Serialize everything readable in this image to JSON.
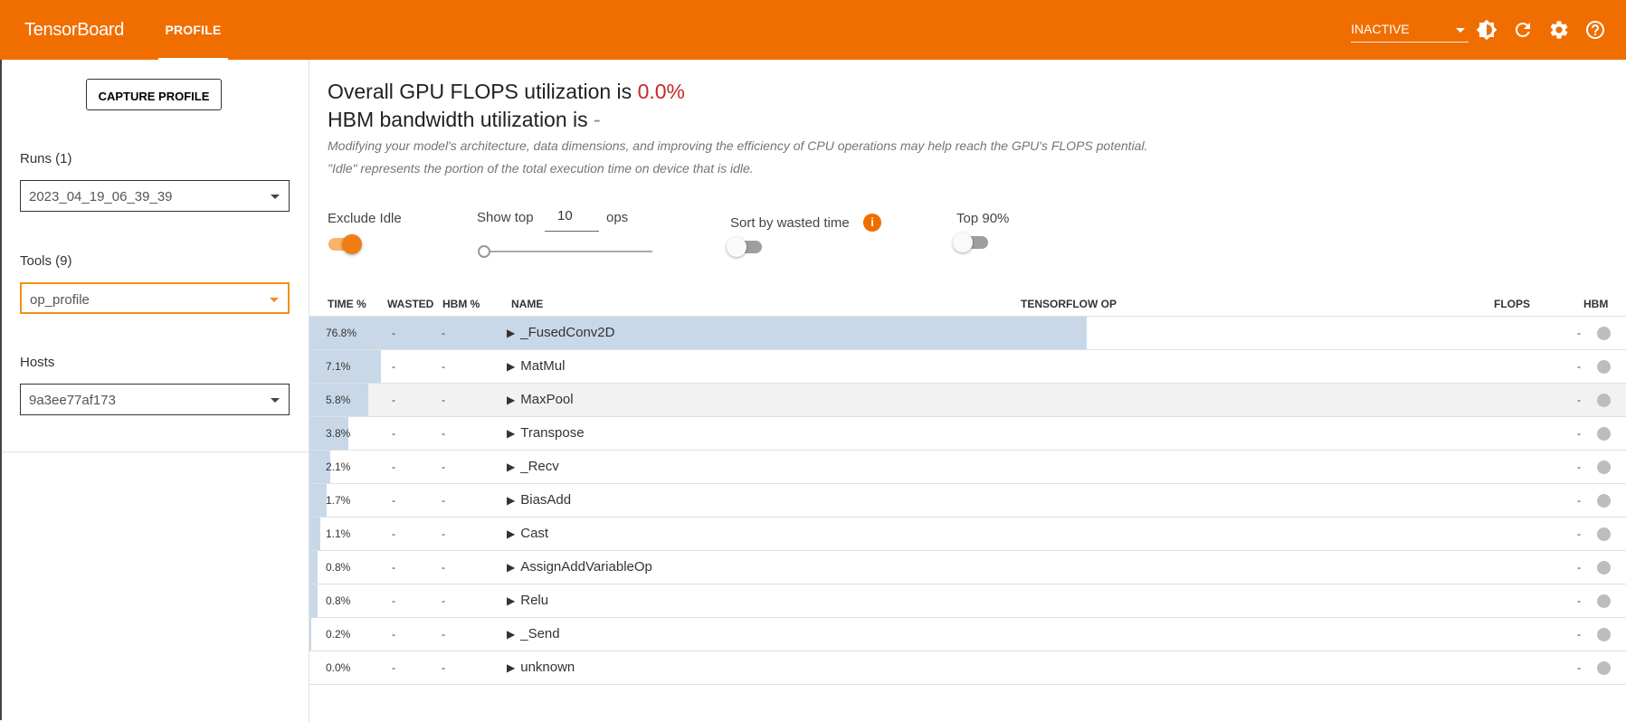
{
  "header": {
    "app_name": "TensorBoard",
    "tab_label": "PROFILE",
    "status_select": "INACTIVE",
    "icons": [
      "theme-toggle-icon",
      "refresh-icon",
      "settings-icon",
      "help-icon"
    ],
    "accent_color": "#f06e00"
  },
  "sidebar": {
    "capture_label": "CAPTURE PROFILE",
    "runs_label": "Runs (1)",
    "runs_value": "2023_04_19_06_39_39",
    "tools_label": "Tools (9)",
    "tools_value": "op_profile",
    "hosts_label": "Hosts",
    "hosts_value": "9a3ee77af173"
  },
  "summary": {
    "flops_prefix": "Overall GPU FLOPS utilization is ",
    "flops_value": "0.0%",
    "hbm_prefix": "HBM bandwidth utilization is ",
    "hbm_value": "-",
    "note1": "Modifying your model's architecture, data dimensions, and improving the efficiency of CPU operations may help reach the GPU's FLOPS potential.",
    "note2": "\"Idle\" represents the portion of the total execution time on device that is idle."
  },
  "controls": {
    "exclude_idle_label": "Exclude Idle",
    "exclude_idle_on": true,
    "show_top_label": "Show top",
    "show_top_value": "10",
    "ops_label": "ops",
    "sort_label": "Sort by wasted time",
    "sort_on": false,
    "info_icon_glyph": "i",
    "top90_label": "Top 90%",
    "top90_on": false
  },
  "table": {
    "headers": {
      "time": "TIME %",
      "wasted": "WASTED",
      "hbm": "HBM %",
      "name": "NAME",
      "tf_op": "TENSORFLOW OP",
      "flops": "FLOPS",
      "hbm_col": "HBM"
    },
    "rows": [
      {
        "time": "76.8%",
        "time_pct": 76.8,
        "wasted": "-",
        "hbm": "-",
        "name": "_FusedConv2D",
        "flops": "-"
      },
      {
        "time": "7.1%",
        "time_pct": 7.1,
        "wasted": "-",
        "hbm": "-",
        "name": "MatMul",
        "flops": "-"
      },
      {
        "time": "5.8%",
        "time_pct": 5.8,
        "wasted": "-",
        "hbm": "-",
        "name": "MaxPool",
        "flops": "-"
      },
      {
        "time": "3.8%",
        "time_pct": 3.8,
        "wasted": "-",
        "hbm": "-",
        "name": "Transpose",
        "flops": "-"
      },
      {
        "time": "2.1%",
        "time_pct": 2.1,
        "wasted": "-",
        "hbm": "-",
        "name": "_Recv",
        "flops": "-"
      },
      {
        "time": "1.7%",
        "time_pct": 1.7,
        "wasted": "-",
        "hbm": "-",
        "name": "BiasAdd",
        "flops": "-"
      },
      {
        "time": "1.1%",
        "time_pct": 1.1,
        "wasted": "-",
        "hbm": "-",
        "name": "Cast",
        "flops": "-"
      },
      {
        "time": "0.8%",
        "time_pct": 0.8,
        "wasted": "-",
        "hbm": "-",
        "name": "AssignAddVariableOp",
        "flops": "-"
      },
      {
        "time": "0.8%",
        "time_pct": 0.8,
        "wasted": "-",
        "hbm": "-",
        "name": "Relu",
        "flops": "-"
      },
      {
        "time": "0.2%",
        "time_pct": 0.2,
        "wasted": "-",
        "hbm": "-",
        "name": "_Send",
        "flops": "-"
      },
      {
        "time": "0.0%",
        "time_pct": 0.0,
        "wasted": "-",
        "hbm": "-",
        "name": "unknown",
        "flops": "-"
      }
    ]
  }
}
